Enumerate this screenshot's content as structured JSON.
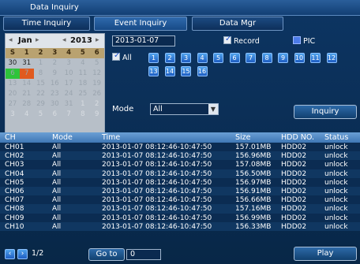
{
  "window": {
    "title": "Data Inquiry"
  },
  "tabs": [
    {
      "label": "Time Inquiry",
      "active": false
    },
    {
      "label": "Event Inquiry",
      "active": true
    },
    {
      "label": "Data Mgr",
      "active": false
    }
  ],
  "calendar": {
    "month": "Jan",
    "year": "2013",
    "weekdays": [
      "S",
      "1",
      "2",
      "3",
      "4",
      "5",
      "6"
    ],
    "rows": [
      [
        "30",
        "31",
        "1",
        "2",
        "3",
        "4",
        "5"
      ],
      [
        "6",
        "7",
        "8",
        "9",
        "10",
        "11",
        "12"
      ],
      [
        "13",
        "14",
        "15",
        "16",
        "17",
        "18",
        "19"
      ],
      [
        "20",
        "21",
        "22",
        "23",
        "24",
        "25",
        "26"
      ],
      [
        "27",
        "28",
        "29",
        "30",
        "31",
        "1",
        "2"
      ],
      [
        "3",
        "4",
        "5",
        "6",
        "7",
        "8",
        "9"
      ]
    ],
    "selected_day": "7",
    "record_day": "6"
  },
  "search": {
    "date": "2013-01-07",
    "record_label": "Record",
    "record_checked": true,
    "pic_label": "PIC",
    "pic_checked": false,
    "all_label": "All",
    "all_checked": true,
    "channels": [
      "1",
      "2",
      "3",
      "4",
      "5",
      "6",
      "7",
      "8",
      "9",
      "10",
      "11",
      "12",
      "13",
      "14",
      "15",
      "16"
    ],
    "mode_label": "Mode",
    "mode_value": "All",
    "inquiry_label": "Inquiry"
  },
  "table": {
    "headers": [
      "CH",
      "Mode",
      "Time",
      "Size",
      "HDD NO.",
      "Status"
    ],
    "rows": [
      [
        "CH01",
        "All",
        "2013-01-07  08:12:46-10:47:50",
        "157.01MB",
        "HDD02",
        "unlock"
      ],
      [
        "CH02",
        "All",
        "2013-01-07  08:12:46-10:47:50",
        "156.96MB",
        "HDD02",
        "unlock"
      ],
      [
        "CH03",
        "All",
        "2013-01-07  08:12:46-10:47:50",
        "157.08MB",
        "HDD02",
        "unlock"
      ],
      [
        "CH04",
        "All",
        "2013-01-07  08:12:46-10:47:50",
        "156.50MB",
        "HDD02",
        "unlock"
      ],
      [
        "CH05",
        "All",
        "2013-01-07  08:12:46-10:47:50",
        "156.97MB",
        "HDD02",
        "unlock"
      ],
      [
        "CH06",
        "All",
        "2013-01-07  08:12:46-10:47:50",
        "156.91MB",
        "HDD02",
        "unlock"
      ],
      [
        "CH07",
        "All",
        "2013-01-07  08:12:46-10:47:50",
        "156.66MB",
        "HDD02",
        "unlock"
      ],
      [
        "CH08",
        "All",
        "2013-01-07  08:12:46-10:47:50",
        "157.16MB",
        "HDD02",
        "unlock"
      ],
      [
        "CH09",
        "All",
        "2013-01-07  08:12:46-10:47:50",
        "156.99MB",
        "HDD02",
        "unlock"
      ],
      [
        "CH10",
        "All",
        "2013-01-07  08:12:46-10:47:50",
        "156.33MB",
        "HDD02",
        "unlock"
      ]
    ]
  },
  "footer": {
    "page": "1/2",
    "goto_label": "Go to",
    "goto_value": "0",
    "play_label": "Play",
    "prev_icon": "chevron-left-icon",
    "next_icon": "chevron-right-icon"
  },
  "colors": {
    "accent": "#2f6aad",
    "record_day": "#2ec43a",
    "selected_day": "#e05a1e",
    "weekday_header": "#b9a270"
  }
}
